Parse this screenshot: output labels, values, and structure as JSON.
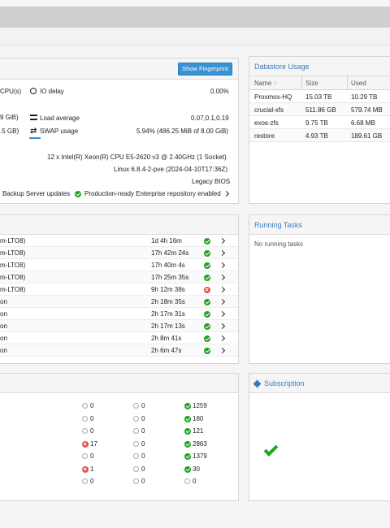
{
  "status": {
    "show_fingerprint": "Show Fingerprint",
    "cpus_fragment": "CPU(s)",
    "io_delay_label": "IO delay",
    "io_delay_value": "0.00%",
    "mem_fragment": "9 GiB)",
    "load_label": "Load average",
    "load_value": "0.07,0.1,0.19",
    "swap_fragment": ".5 GB)",
    "swap_label": "SWAP usage",
    "swap_value": "5.94% (486.25 MiB of 8.00 GiB)",
    "cpu_model": "12 x Intel(R) Xeon(R) CPU E5-2620 v3 @ 2.40GHz (1 Socket)",
    "kernel": "Linux 6.8.4-2-pve (2024-04-10T17:36Z)",
    "boot_mode": "Legacy BIOS",
    "updates_text": "Backup Server updates",
    "repo_text": "Production-ready Enterprise repository enabled"
  },
  "datastore": {
    "title": "Datastore Usage",
    "headers": {
      "name": "Name",
      "size": "Size",
      "used": "Used"
    },
    "rows": [
      {
        "name": "Proxmox-HQ",
        "size": "15.03 TB",
        "used": "10.29 TB"
      },
      {
        "name": "crucial-xfs",
        "size": "511.86 GB",
        "used": "579.74 MB"
      },
      {
        "name": "exos-zfs",
        "size": "9.75 TB",
        "used": "6.68 MB"
      },
      {
        "name": "restore",
        "size": "4.93 TB",
        "used": "189.61 GB"
      }
    ]
  },
  "tasks": {
    "rows": [
      {
        "name": "m-LTO8)",
        "duration": "1d 4h 16m",
        "status": "ok"
      },
      {
        "name": "m-LTO8)",
        "duration": "17h 42m 24s",
        "status": "ok"
      },
      {
        "name": "m-LTO8)",
        "duration": "17h 40m 4s",
        "status": "ok"
      },
      {
        "name": "m-LTO8)",
        "duration": "17h 25m 35s",
        "status": "ok"
      },
      {
        "name": "m-LTO8)",
        "duration": "9h 12m 38s",
        "status": "error"
      },
      {
        "name": "on",
        "duration": "2h 18m 35s",
        "status": "ok"
      },
      {
        "name": "on",
        "duration": "2h 17m 31s",
        "status": "ok"
      },
      {
        "name": "on",
        "duration": "2h 17m 13s",
        "status": "ok"
      },
      {
        "name": "on",
        "duration": "2h 8m 41s",
        "status": "ok"
      },
      {
        "name": "on",
        "duration": "2h 6m 47s",
        "status": "ok"
      }
    ]
  },
  "running_tasks": {
    "title": "Running Tasks",
    "empty": "No running tasks"
  },
  "summary": {
    "rows": [
      {
        "a": "0",
        "a_s": "grey",
        "b": "0",
        "b_s": "grey",
        "c": "1259",
        "c_s": "ok"
      },
      {
        "a": "0",
        "a_s": "grey",
        "b": "0",
        "b_s": "grey",
        "c": "180",
        "c_s": "ok"
      },
      {
        "a": "0",
        "a_s": "grey",
        "b": "0",
        "b_s": "grey",
        "c": "121",
        "c_s": "ok"
      },
      {
        "a": "17",
        "a_s": "error",
        "b": "0",
        "b_s": "grey",
        "c": "2863",
        "c_s": "ok"
      },
      {
        "a": "0",
        "a_s": "grey",
        "b": "0",
        "b_s": "grey",
        "c": "1379",
        "c_s": "ok"
      },
      {
        "a": "1",
        "a_s": "error",
        "b": "0",
        "b_s": "grey",
        "c": "30",
        "c_s": "ok"
      },
      {
        "a": "0",
        "a_s": "grey",
        "b": "0",
        "b_s": "grey",
        "c": "0",
        "c_s": "grey"
      }
    ]
  },
  "subscription": {
    "title": "Subscription"
  },
  "colors": {
    "accent": "#3a7bc0",
    "ok": "#21a121",
    "error": "#d9534f",
    "button": "#3892d4"
  }
}
